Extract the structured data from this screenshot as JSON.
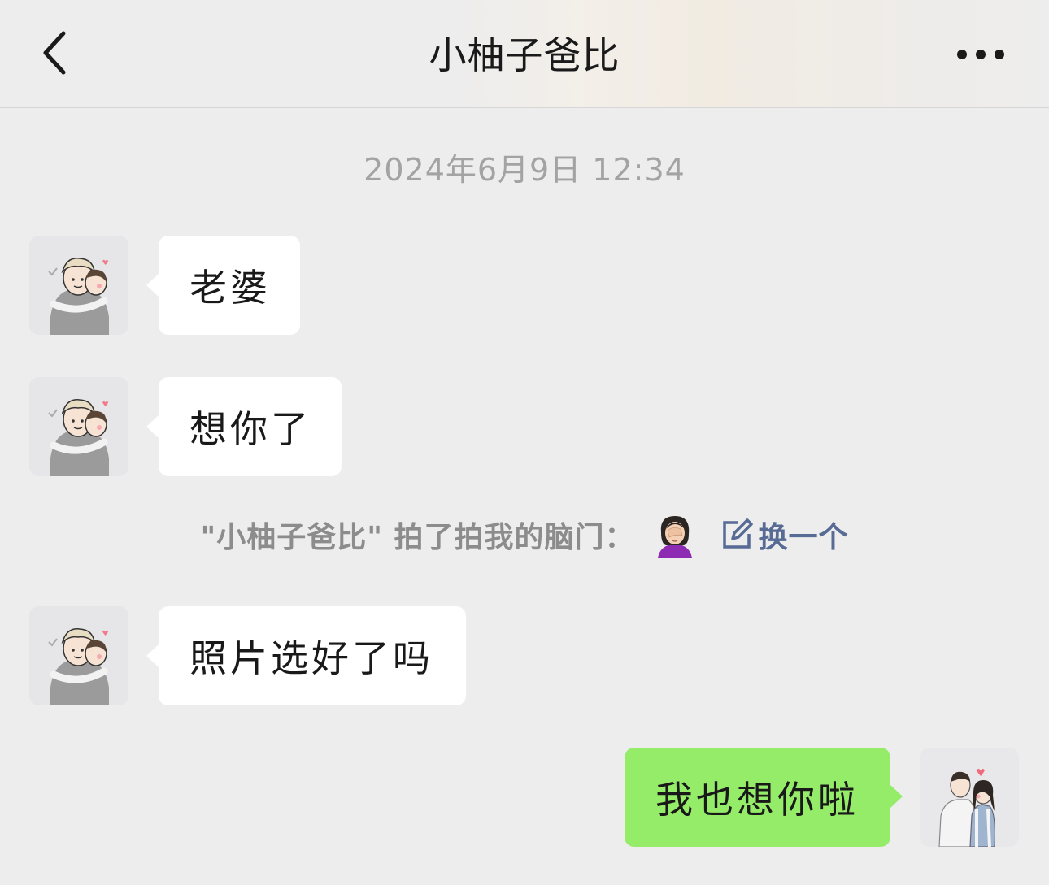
{
  "header": {
    "title": "小柚子爸比",
    "back_icon": "chevron-left-icon",
    "more_icon": "more-dots-icon"
  },
  "timestamp": "2024年6月9日 12:34",
  "messages": [
    {
      "side": "incoming",
      "text": "老婆"
    },
    {
      "side": "incoming",
      "text": "想你了"
    },
    {
      "side": "incoming",
      "text": "照片选好了吗"
    },
    {
      "side": "outgoing",
      "text": "我也想你啦"
    }
  ],
  "pat_notice": {
    "text": "\"小柚子爸比\" 拍了拍我的脑门：",
    "emoji_icon": "facepalm-woman-icon",
    "action_label": "换一个",
    "action_icon": "edit-icon"
  },
  "colors": {
    "background": "#ededed",
    "incoming_bubble": "#ffffff",
    "outgoing_bubble": "#95ec69",
    "link": "#576b95",
    "timestamp": "#a3a3a3"
  }
}
